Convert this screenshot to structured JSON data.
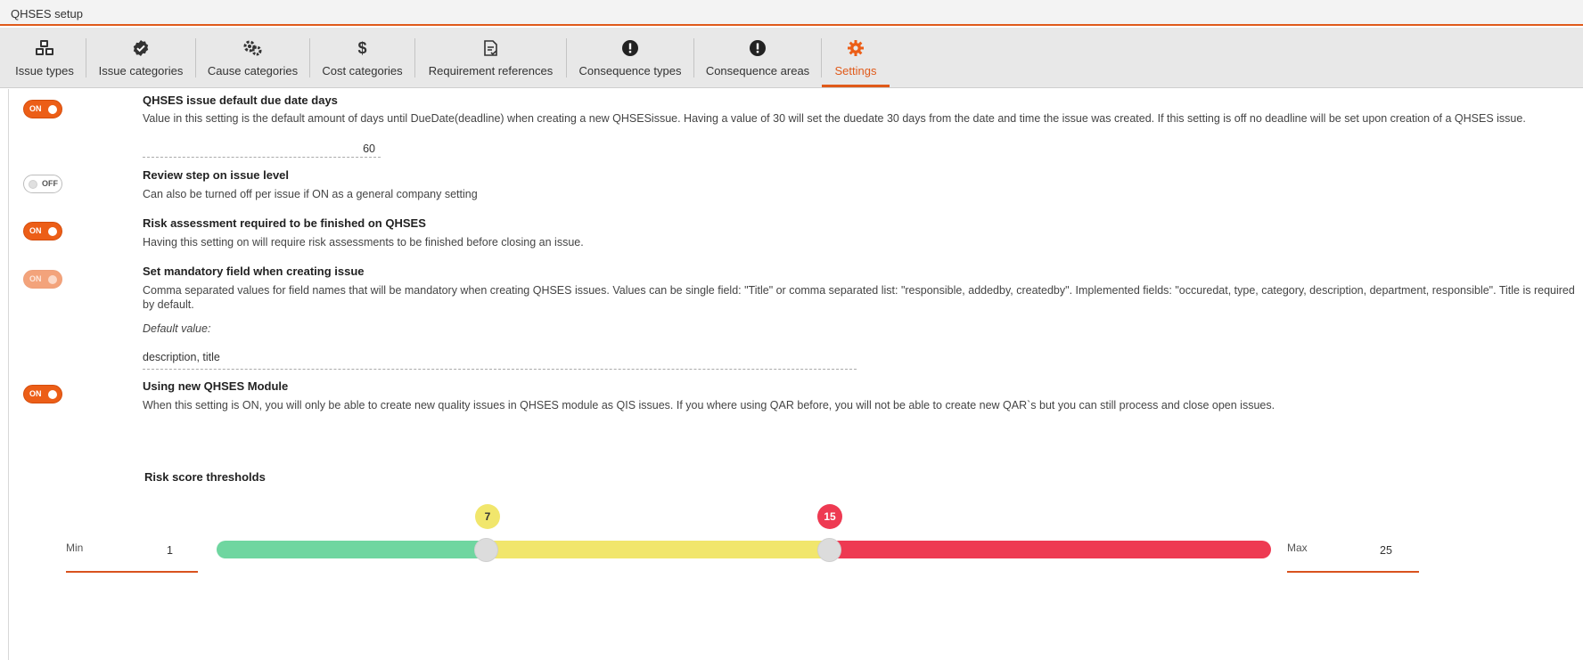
{
  "window": {
    "title": "QHSES setup"
  },
  "tabs": [
    {
      "label": "Issue types",
      "icon": "cubes-icon"
    },
    {
      "label": "Issue categories",
      "icon": "check-badge-icon"
    },
    {
      "label": "Cause categories",
      "icon": "gears-icon"
    },
    {
      "label": "Cost categories",
      "icon": "dollar-icon"
    },
    {
      "label": "Requirement references",
      "icon": "document-check-icon"
    },
    {
      "label": "Consequence types",
      "icon": "exclamation-circle-icon"
    },
    {
      "label": "Consequence areas",
      "icon": "exclamation-circle-icon"
    },
    {
      "label": "Settings",
      "icon": "gear-icon",
      "active": true
    }
  ],
  "settings": {
    "due_date": {
      "toggle": "ON",
      "title": "QHSES issue default due date days",
      "description": "Value in this setting is the default amount of days until DueDate(deadline) when creating a new QHSESissue. Having a value of 30 will set the duedate 30 days from the date and time the issue was created. If this setting is off no deadline will be set upon creation of a QHSES issue.",
      "value": "60"
    },
    "review_step": {
      "toggle": "OFF",
      "title": "Review step on issue level",
      "description": "Can also be turned off per issue if ON as a general company setting"
    },
    "risk_assessment": {
      "toggle": "ON",
      "title": "Risk assessment required to be finished on QHSES",
      "description": "Having this setting on will require risk assessments to be finished before closing an issue."
    },
    "mandatory_field": {
      "toggle": "ON",
      "title": "Set mandatory field when creating issue",
      "description": "Comma separated values for field names that will be mandatory when creating QHSES issues. Values can be single field: \"Title\" or comma separated list: \"responsible, addedby, createdby\". Implemented fields: \"occuredat, type, category, description, department, responsible\". Title is required by default.",
      "default_label": "Default value:",
      "value": "description, title"
    },
    "new_module": {
      "toggle": "ON",
      "title": "Using new QHSES Module",
      "description": "When this setting is ON, you will only be able to create new quality issues in QHSES module as QIS issues. If you where using QAR before, you will not be able to create new QAR`s but you can still process and close open issues."
    }
  },
  "risk": {
    "title": "Risk score thresholds",
    "min_label": "Min",
    "min_value": "1",
    "max_label": "Max",
    "max_value": "25",
    "low_threshold": "7",
    "high_threshold": "15",
    "colors": {
      "low": "#6fd6a0",
      "mid": "#f1e66c",
      "high": "#ee3a52",
      "accent": "#ec5e17"
    }
  }
}
